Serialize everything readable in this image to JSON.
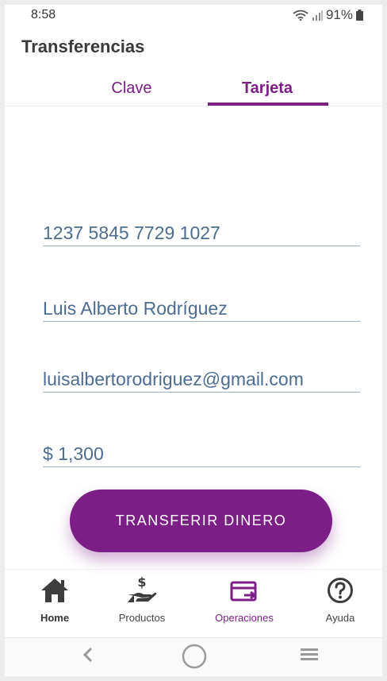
{
  "status_bar": {
    "time": "8:58",
    "battery": "91%"
  },
  "header": {
    "title": "Transferencias"
  },
  "tabs": [
    {
      "label": "Clave",
      "active": false
    },
    {
      "label": "Tarjeta",
      "active": true
    }
  ],
  "form": {
    "card_number": "1237 5845 7729 1027",
    "name": "Luis Alberto Rodríguez",
    "email": "luisalbertorodriguez@gmail.com",
    "amount": "$ 1,300"
  },
  "primary_button": {
    "label": "TRANSFERIR DINERO"
  },
  "bottom_nav": [
    {
      "label": "Home",
      "icon": "home-icon",
      "active": false
    },
    {
      "label": "Productos",
      "icon": "hand-money-icon",
      "active": false
    },
    {
      "label": "Operaciones",
      "icon": "transfer-card-icon",
      "active": true
    },
    {
      "label": "Ayuda",
      "icon": "help-icon",
      "active": false
    }
  ],
  "system_nav": {
    "icons": [
      "back-icon",
      "home-circle-icon",
      "recents-icon"
    ]
  },
  "colors": {
    "accent": "#7b1f87",
    "input_text": "#4c6c91",
    "background": "#ffffff"
  }
}
